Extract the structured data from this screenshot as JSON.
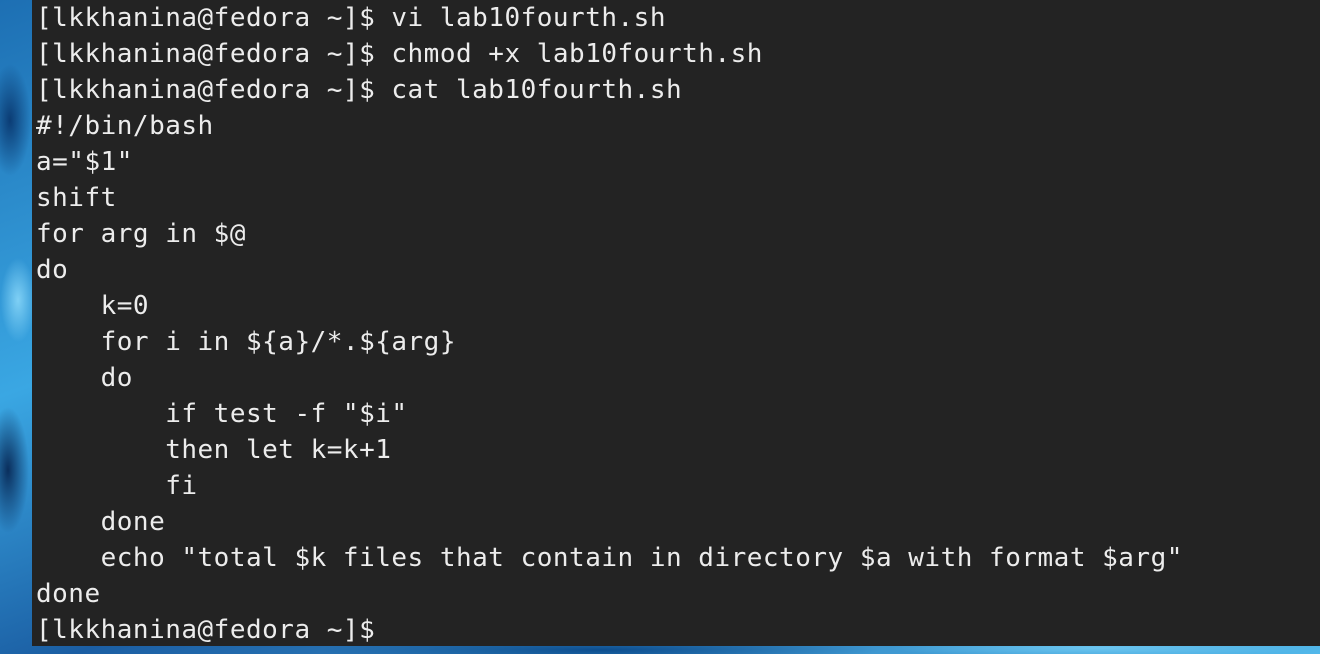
{
  "terminal": {
    "lines": [
      "[lkkhanina@fedora ~]$ vi lab10fourth.sh",
      "[lkkhanina@fedora ~]$ chmod +x lab10fourth.sh",
      "[lkkhanina@fedora ~]$ cat lab10fourth.sh",
      "#!/bin/bash",
      "a=\"$1\"",
      "shift",
      "for arg in $@",
      "do",
      "    k=0",
      "    for i in ${a}/*.${arg}",
      "    do",
      "        if test -f \"$i\"",
      "        then let k=k+1",
      "        fi",
      "    done",
      "    echo \"total $k files that contain in directory $a with format $arg\"",
      "done",
      "[lkkhanina@fedora ~]$ "
    ]
  },
  "colors": {
    "terminal_bg": "#232323",
    "terminal_fg": "#ececec",
    "wallpaper_accent": "#2a8fd0"
  }
}
